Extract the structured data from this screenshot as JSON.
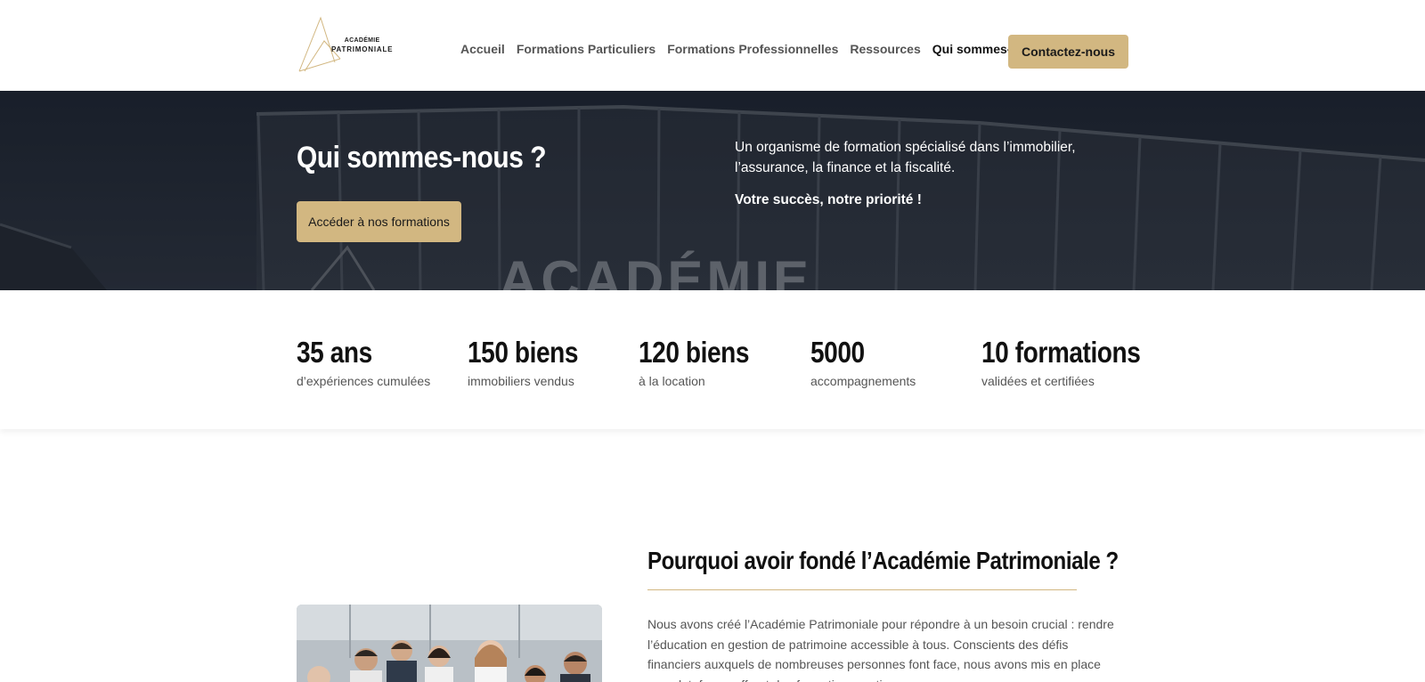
{
  "header": {
    "logo": {
      "line1": "ACADÉMIE",
      "line2": "PATRIMONIALE"
    },
    "nav": [
      {
        "label": "Accueil"
      },
      {
        "label": "Formations Particuliers"
      },
      {
        "label": "Formations Professionnelles"
      },
      {
        "label": "Ressources"
      },
      {
        "label": "Qui sommes-nous ?"
      }
    ],
    "cta_label": "Contactez-nous"
  },
  "hero": {
    "title": "Qui sommes-nous ?",
    "button_label": "Accéder à nos formations",
    "description": "Un organisme de formation spécialisé dans l’immobilier, l’assurance, la finance et la fiscalité.",
    "tagline": "Votre succès, notre priorité !",
    "background_sign_text": "ACADÉMIE"
  },
  "stats": [
    {
      "value": "35 ans",
      "label": "d’expériences cumulées"
    },
    {
      "value": "150 biens",
      "label": "immobiliers vendus"
    },
    {
      "value": "120 biens",
      "label": "à la location"
    },
    {
      "value": "5000",
      "label": "accompagnements"
    },
    {
      "value": "10 formations",
      "label": "validées et certifiées"
    }
  ],
  "about": {
    "title": "Pourquoi avoir fondé l’Académie Patrimoniale ?",
    "paragraph": "Nous avons créé l’Académie Patrimoniale pour répondre à un besoin crucial : rendre l’éducation en gestion de patrimoine accessible à tous. Conscients des défis financiers auxquels de nombreuses personnes font face, nous avons mis en place une plateforme offrant des formations pratiques."
  },
  "colors": {
    "accent": "#d2b781",
    "hero_bg": "#262c36",
    "text_dark": "#111111",
    "text_muted": "#555555"
  }
}
